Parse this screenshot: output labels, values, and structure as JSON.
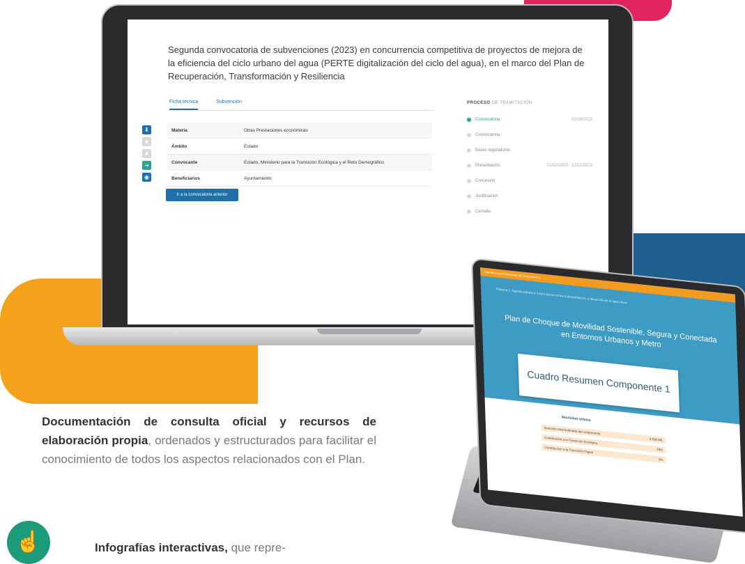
{
  "colors": {
    "accent_blue": "#1f6fa8",
    "orange": "#f4a21c",
    "pink": "#e0245e",
    "green": "#1c9b7a",
    "dark_blue": "#1f5f8f"
  },
  "main_screen": {
    "title": "Segunda convocatoria de subvenciones (2023) en concurrencia competitiva de proyectos de mejora de la eficiencia del ciclo urbano del agua (PERTE digitalización del ciclo del agua), en el marco del Plan de Recuperación, Transformación y Resiliencia",
    "tabs": [
      {
        "label": "Ficha técnica",
        "active": true
      },
      {
        "label": "Subvención",
        "active": false
      }
    ],
    "side_icons": [
      {
        "name": "download-icon",
        "glyph": "⬇",
        "color": "#1f6fa8"
      },
      {
        "name": "square-icon",
        "glyph": "■",
        "color": "#d9d9d9"
      },
      {
        "name": "square-icon",
        "glyph": "■",
        "color": "#d9d9d9"
      },
      {
        "name": "share-icon",
        "glyph": "➜",
        "color": "#2aa58f"
      },
      {
        "name": "globe-icon",
        "glyph": "◉",
        "color": "#1f6fa8"
      }
    ],
    "info_rows": [
      {
        "key": "Materia",
        "value": "Otras Prestaciones económicas"
      },
      {
        "key": "Ámbito",
        "value": "Estado"
      },
      {
        "key": "Convocante",
        "value": "Estado, Ministerio para la Transición Ecológica y el Reto Demográfico"
      },
      {
        "key": "Beneficiarios",
        "value": "Ayuntamiento"
      }
    ],
    "prev_button": "Ir a la convocatoria anterior",
    "process": {
      "title_bold": "PROCESO",
      "title_rest": "DE TRAMITACIÓN",
      "steps": [
        {
          "label": "Convocatoria",
          "date": "02/08/2023",
          "active": true
        },
        {
          "label": "Convocatoria",
          "date": "",
          "active": false
        },
        {
          "label": "Bases reguladoras",
          "date": "",
          "active": false
        },
        {
          "label": "Presentación",
          "date": "21/10/2023 - 12/12/2023",
          "active": false
        },
        {
          "label": "Concesión",
          "date": "",
          "active": false
        },
        {
          "label": "Justificación",
          "date": "",
          "active": false
        },
        {
          "label": "Cerrada",
          "date": "",
          "active": false
        }
      ]
    }
  },
  "second_screen": {
    "top_bar": "Apuntes  Cuadro Resumen del Componente 1",
    "subtitle": "Palanca 1: Agenda urbana y rural y lucha contra la despoblación, y desarrollo de la agricultura",
    "title": "Plan de Choque de Movilidad Sostenible, Segura y Conectada en Entornos Urbanos y Metro",
    "card": "Cuadro Resumen Componente 1",
    "section": "Movilidad Urbana",
    "rows": [
      {
        "label": "Inversión total estimada del componente",
        "value": "6.536 M€"
      },
      {
        "label": "Contribución a la Transición Ecológica",
        "value": "78%"
      },
      {
        "label": "Contribución a la Transición Digital",
        "value": "3%"
      }
    ]
  },
  "text": {
    "desc_bold": "Documentación de consulta oficial y recursos de elaboración propia",
    "desc_rest": ", ordenados y estructurados para facilitar el conocimiento de todos los aspectos relacionados con el Plan.",
    "infog_bold": "Infografías interactivas,",
    "infog_rest": " que repre-"
  }
}
